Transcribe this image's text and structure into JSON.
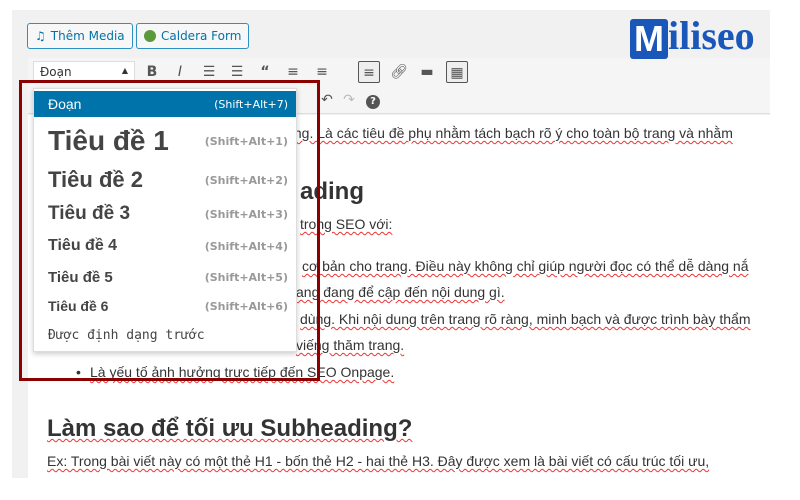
{
  "media_buttons": {
    "add_media": "Thêm Media",
    "caldera": "Caldera Form"
  },
  "logo": {
    "text": "Miliseo",
    "mark": "M",
    "rest": "iliseo"
  },
  "toolbar": {
    "format_select": "Đoạn",
    "icons": [
      "bold-icon",
      "italic-icon",
      "bullet-list-icon",
      "numbered-list-icon",
      "blockquote-icon",
      "align-left-icon",
      "align-center-icon",
      "align-right-icon",
      "link-icon",
      "read-more-icon",
      "toolbar-toggle-icon",
      "undo-icon",
      "redo-icon",
      "help-icon"
    ]
  },
  "format_menu": {
    "items": [
      {
        "label": "Đoạn",
        "shortcut": "(Shift+Alt+7)",
        "selected": true
      },
      {
        "label": "Tiêu đề 1",
        "shortcut": "(Shift+Alt+1)"
      },
      {
        "label": "Tiêu đề 2",
        "shortcut": "(Shift+Alt+2)"
      },
      {
        "label": "Tiêu đề 3",
        "shortcut": "(Shift+Alt+3)"
      },
      {
        "label": "Tiêu đề 4",
        "shortcut": "(Shift+Alt+4)"
      },
      {
        "label": "Tiêu đề 5",
        "shortcut": "(Shift+Alt+5)"
      },
      {
        "label": "Tiêu đề 6",
        "shortcut": "(Shift+Alt+6)"
      },
      {
        "label": "Được định dạng trước",
        "shortcut": ""
      }
    ]
  },
  "content": {
    "line1": "ding. Là các tiêu đề phụ nhằm tách bạch rõ ý cho toàn bộ trang và nhằm",
    "heading1": "ading",
    "line2": "trong SEO với:",
    "line3": "cơ bản cho trang. Điều này không chỉ giúp người đọc có thể dễ dàng nắ",
    "line4": "ang đang để cập đến nội dung gì.",
    "line5": "dùng. Khi nội dung trên trang rõ ràng, minh bạch và được trình bày thẩm",
    "line6": "viếng thăm trang.",
    "bullet": "Là yếu tố ảnh hưởng trực tiếp đến SEO Onpage.",
    "heading2": "Làm sao để tối ưu Subheading?",
    "line7": "Ex: Trong bài viết này có một thẻ H1 - bốn thẻ H2 - hai thẻ H3. Đây được xem là bài viết có cấu trúc tối ưu,"
  },
  "colors": {
    "accent": "#0073aa",
    "highlight_box": "#8b0000",
    "logo": "#1a57b8"
  }
}
